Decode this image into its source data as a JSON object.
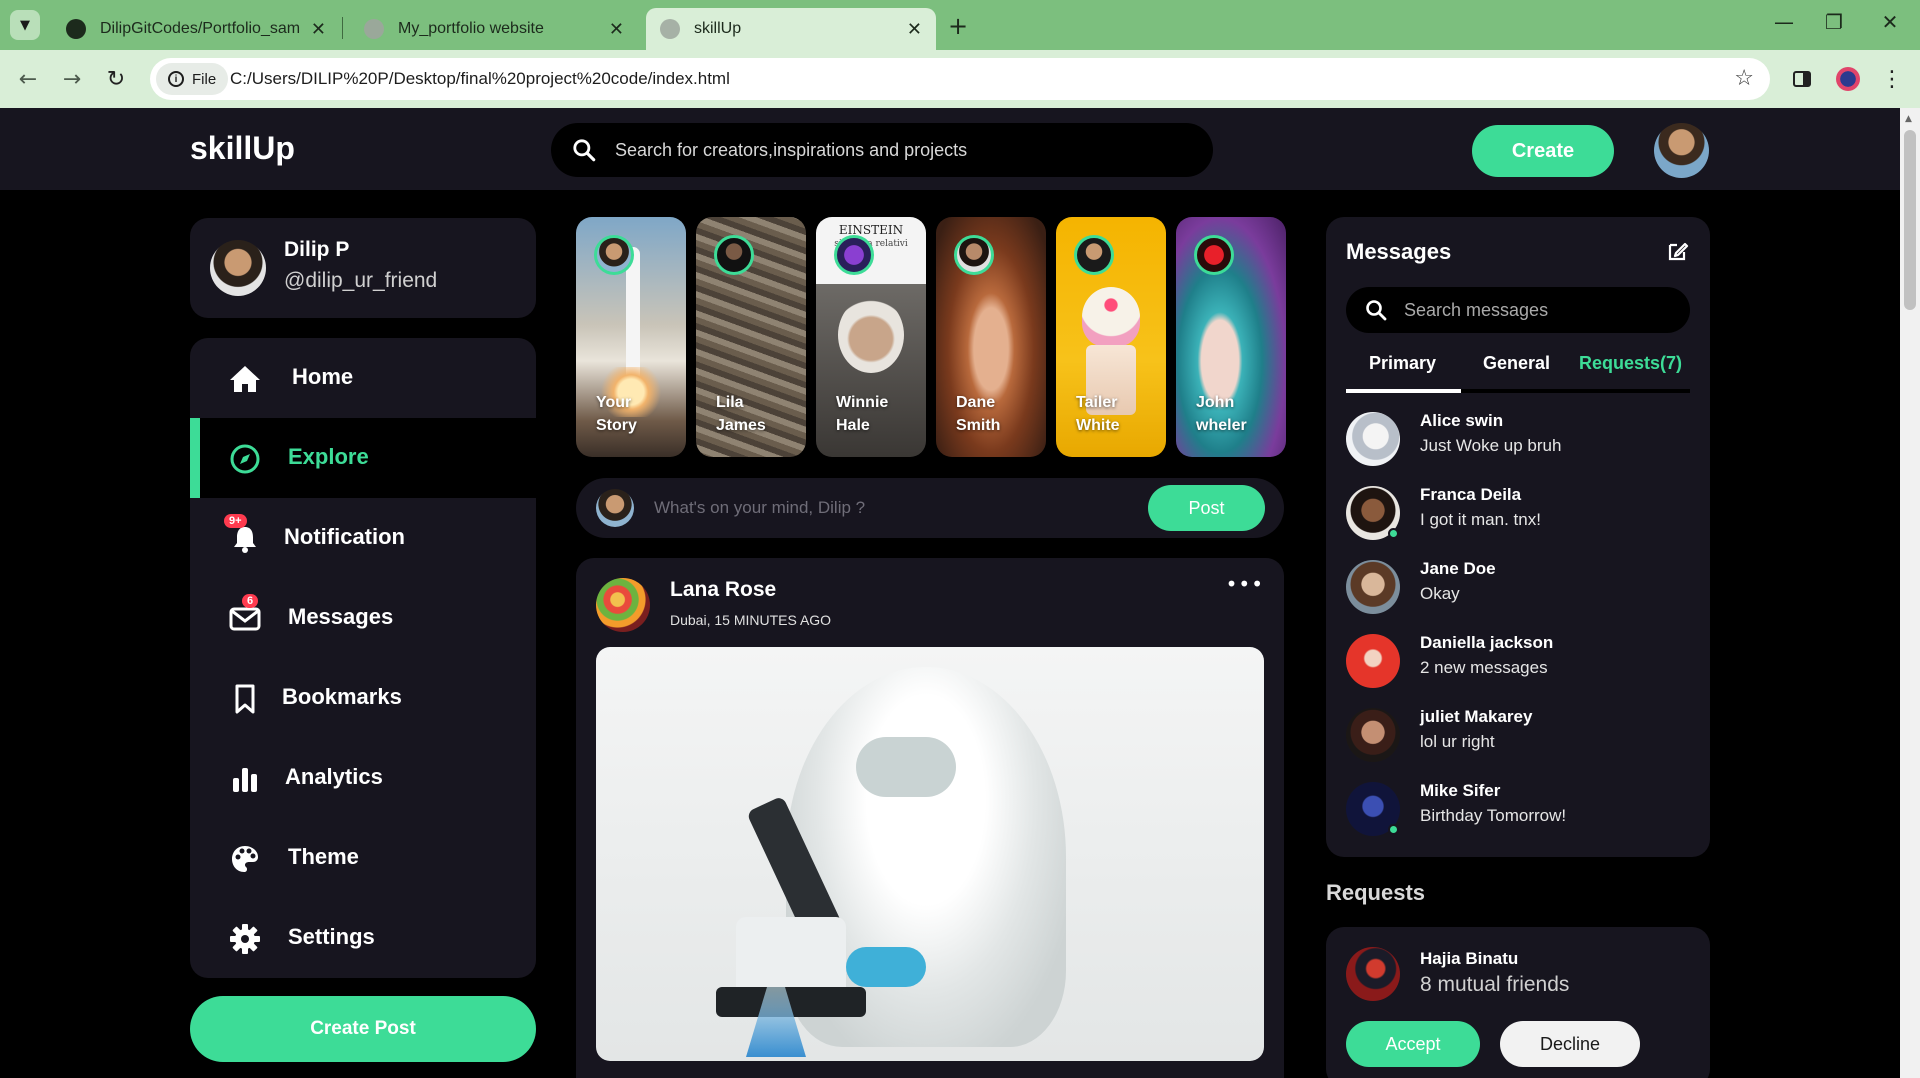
{
  "browser": {
    "tabs": [
      {
        "title": "DilipGitCodes/Portfolio_sample",
        "favicon": "github-icon"
      },
      {
        "title": "My_portfolio website",
        "favicon": "globe-icon"
      },
      {
        "title": "skillUp",
        "favicon": "globe-icon",
        "active": true
      }
    ],
    "file_chip": "File",
    "url": "C:/Users/DILIP%20P/Desktop/final%20project%20code/index.html"
  },
  "app": {
    "logo": "skillUp",
    "search_placeholder": "Search for creators,inspirations and projects",
    "create_label": "Create"
  },
  "profile": {
    "name": "Dilip P",
    "handle": "@dilip_ur_friend"
  },
  "sidebar": {
    "items": [
      {
        "label": "Home",
        "icon": "home-icon"
      },
      {
        "label": "Explore",
        "icon": "compass-icon",
        "active": true
      },
      {
        "label": "Notification",
        "icon": "bell-icon",
        "badge": "9+"
      },
      {
        "label": "Messages",
        "icon": "envelope-icon",
        "badge": "6"
      },
      {
        "label": "Bookmarks",
        "icon": "bookmark-icon"
      },
      {
        "label": "Analytics",
        "icon": "bar-chart-icon"
      },
      {
        "label": "Theme",
        "icon": "palette-icon"
      },
      {
        "label": "Settings",
        "icon": "gear-icon"
      }
    ],
    "create_post_label": "Create Post"
  },
  "stories": [
    {
      "name": "Your Story"
    },
    {
      "name": "Lila James"
    },
    {
      "name": "Winnie Hale"
    },
    {
      "name": "Dane Smith"
    },
    {
      "name": "Tailer White"
    },
    {
      "name": "John wheler"
    }
  ],
  "story_extra": {
    "einstein_title": "EINSTEIN",
    "einstein_sub": "sign ella relativi"
  },
  "compose": {
    "placeholder": "What's on your mind, Dilip ?",
    "post_label": "Post"
  },
  "feed": {
    "author": "Lana Rose",
    "meta": "Dubai, 15 MINUTES AGO",
    "more": "•••"
  },
  "messages": {
    "title": "Messages",
    "search_placeholder": "Search messages",
    "tabs": [
      "Primary",
      "General",
      "Requests(7)"
    ],
    "list": [
      {
        "name": "Alice swin",
        "text": "Just Woke up bruh",
        "online": false
      },
      {
        "name": "Franca Deila",
        "text": "I got it man. tnx!",
        "online": true
      },
      {
        "name": "Jane Doe",
        "text": "Okay",
        "online": false
      },
      {
        "name": "Daniella jackson",
        "text": "2 new messages",
        "online": false
      },
      {
        "name": "juliet Makarey",
        "text": "lol ur right",
        "online": false
      },
      {
        "name": "Mike Sifer",
        "text": "Birthday Tomorrow!",
        "online": true
      }
    ]
  },
  "requests": {
    "title": "Requests",
    "name": "Hajia Binatu",
    "mutual": "8 mutual friends",
    "accept_label": "Accept",
    "decline_label": "Decline"
  },
  "colors": {
    "accent": "#3ddc97",
    "card": "#17151f",
    "badge": "#ff3b4f"
  }
}
